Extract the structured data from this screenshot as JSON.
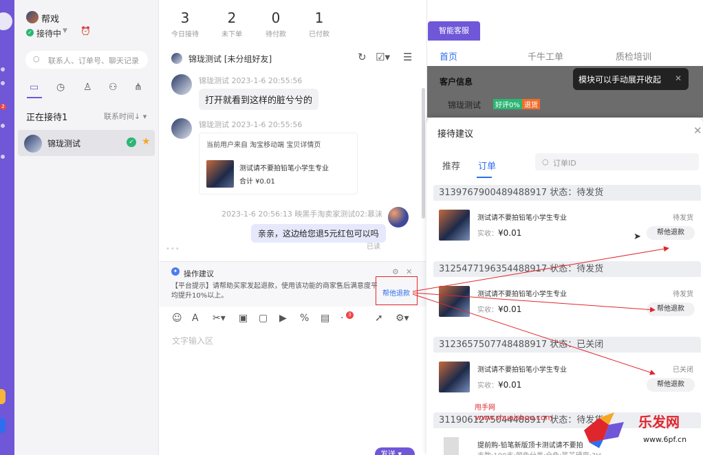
{
  "stats": [
    {
      "num": "3",
      "label": "今日接待"
    },
    {
      "num": "2",
      "label": "未下单"
    },
    {
      "num": "0",
      "label": "待付款"
    },
    {
      "num": "1",
      "label": "已付款"
    }
  ],
  "profile": {
    "name": "帮戏",
    "status": "接待中",
    "status_caret": "▼"
  },
  "search": {
    "placeholder": "联系人、订单号、聊天记录"
  },
  "waiting": {
    "title": "正在接待1",
    "sort": "联系时间↓ ▾"
  },
  "contact": {
    "name": "锦珑测试"
  },
  "chat": {
    "title": "锦珑测试 [未分组好友]",
    "messages": [
      {
        "meta": "锦珑测试   2023-1-6 20:55:56",
        "text": "打开就看到这样的脏兮兮的"
      },
      {
        "meta": "锦珑测试   2023-1-6 20:55:56"
      }
    ],
    "card": {
      "source": "当前用户来自 淘宝移动端 宝贝详情页",
      "title": "测试请不要拍铅笔小学生专业",
      "price": "合计 ¥0.01"
    },
    "my_meta": "2023-1-6 20:56:13    映黑手淘卖家测试02:慕沫",
    "my_text": "亲亲，这边给您退5元红包可以吗",
    "read": "已读"
  },
  "suggestion": {
    "title": "操作建议",
    "text": "【平台提示】请帮助买家发起退款，使用该功能的商家售后满意度平均提升10%以上。",
    "link": "帮他退款"
  },
  "toolbar_badge": "3",
  "input": {
    "placeholder": "文字输入区",
    "send": "发送"
  },
  "right": {
    "smart_tab": "智能客服",
    "nav": [
      "首页",
      "千牛工单",
      "质检培训"
    ],
    "customer_info": "客户信息",
    "customer_name": "锦珑测试",
    "tag1": "好评0%",
    "tag2": "退货",
    "tooltip": "模块可以手动展开收起",
    "tooltip_close": "✕"
  },
  "sheet": {
    "title": "接待建议",
    "close": "✕",
    "tabs": [
      "推荐",
      "订单"
    ],
    "search_placeholder": "订单ID",
    "orders": [
      {
        "head": "3139767900489488917  状态：待发货",
        "title": "测试请不要拍铅笔小学生专业",
        "status": "待发货",
        "price_label": "实收：",
        "price": "¥0.01",
        "button": "帮他退款"
      },
      {
        "head": "3125477196354488917  状态：待发货",
        "title": "测试请不要拍铅笔小学生专业",
        "status": "待发货",
        "price_label": "实收：",
        "price": "¥0.01",
        "button": "帮他退款"
      },
      {
        "head": "3123657507748488917  状态：已关闭",
        "title": "测试请不要拍铅笔小学生专业",
        "status": "已关闭",
        "price_label": "实收：",
        "price": "¥0.01",
        "button": "帮他退款"
      }
    ],
    "last_order": {
      "head": "3119061275044488917  状态：待发货",
      "title": "提前购-铅笔新版顶卡测试请不要拍",
      "meta": "支数:100支;颜色分类:全色;笔芯硬度:3H"
    }
  },
  "watermark": {
    "l1": "甩手网",
    "l2": "www.shuaishou.com",
    "brand": "乐发网",
    "url": "www.6pf.cn"
  },
  "colors": {
    "accent": "#6f57d8",
    "link": "#2c6ef0",
    "annotation": "#e0262d"
  }
}
